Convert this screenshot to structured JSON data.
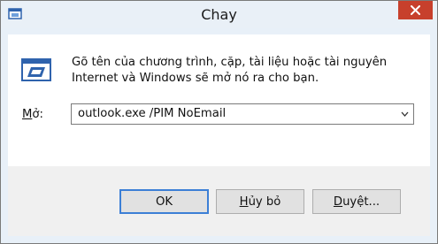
{
  "window": {
    "title": "Chay",
    "close_glyph": "✕"
  },
  "content": {
    "description_line1": "Gõ tên của chương trình, cặp, tài liệu hoặc tài nguyên",
    "description_line2": "Internet và Windows sẽ mở nó ra cho bạn.",
    "open_label_mnemonic": "M",
    "open_label_rest": "ở:",
    "open_value": "outlook.exe /PIM NoEmail"
  },
  "buttons": {
    "ok_label": "OK",
    "cancel_label_mnemonic": "H",
    "cancel_label_rest": "ủy bỏ",
    "browse_label_mnemonic": "D",
    "browse_label_rest": "uyệt..."
  },
  "icons": {
    "app": "run-dialog-icon",
    "run": "run-program-icon",
    "close": "close-icon",
    "dropdown": "chevron-down-icon"
  },
  "colors": {
    "titlebar": "#e9f0f7",
    "close_button": "#c7402c",
    "client": "#ffffff",
    "footer": "#f0f0f0",
    "default_button_border": "#3c7fd6",
    "icon_blue": "#2f63ad"
  }
}
